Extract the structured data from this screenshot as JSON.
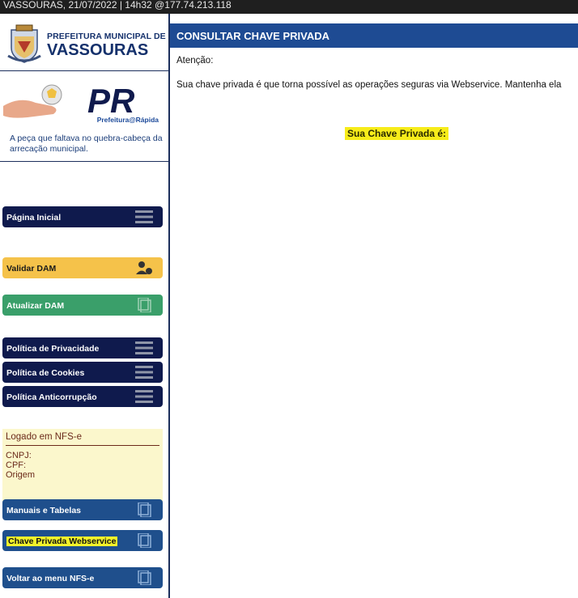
{
  "topbar": {
    "text": "VASSOURAS, 21/07/2022 | 14h32 @177.74.213.118"
  },
  "logo": {
    "line1": "PREFEITURA MUNICIPAL DE",
    "line2": "VASSOURAS"
  },
  "pr": {
    "logo_text": "PR",
    "subtitle": "Prefeitura@Rápida",
    "caption": "A peça que faltava no quebra-cabeça da arrecação municipal."
  },
  "menu": {
    "home": "Página Inicial",
    "validar_dam": "Validar DAM",
    "atualizar_dam": "Atualizar DAM",
    "privacidade": "Política de Privacidade",
    "cookies": "Política de Cookies",
    "anticorrupcao": "Política Anticorrupção",
    "manuais": "Manuais e Tabelas",
    "chave": "Chave Privada Webservice",
    "voltar": "Voltar ao menu NFS-e"
  },
  "login_box": {
    "title": "Logado em NFS-e",
    "cnpj": "CNPJ:",
    "cpf": "CPF:",
    "origem": "Origem"
  },
  "main": {
    "header": "CONSULTAR CHAVE PRIVADA",
    "atencao": "Atenção:",
    "description": "Sua chave privada é que torna possível as operações seguras via Webservice. Mantenha ela",
    "key_label": "Sua Chave Privada é:"
  },
  "colors": {
    "navy": "#0f1a4d",
    "header_blue": "#1e4b93",
    "yellow_btn": "#f5c24a",
    "green_btn": "#3a9f6a",
    "blue_btn": "#1f4f8c",
    "highlight": "#f7ec1a"
  }
}
